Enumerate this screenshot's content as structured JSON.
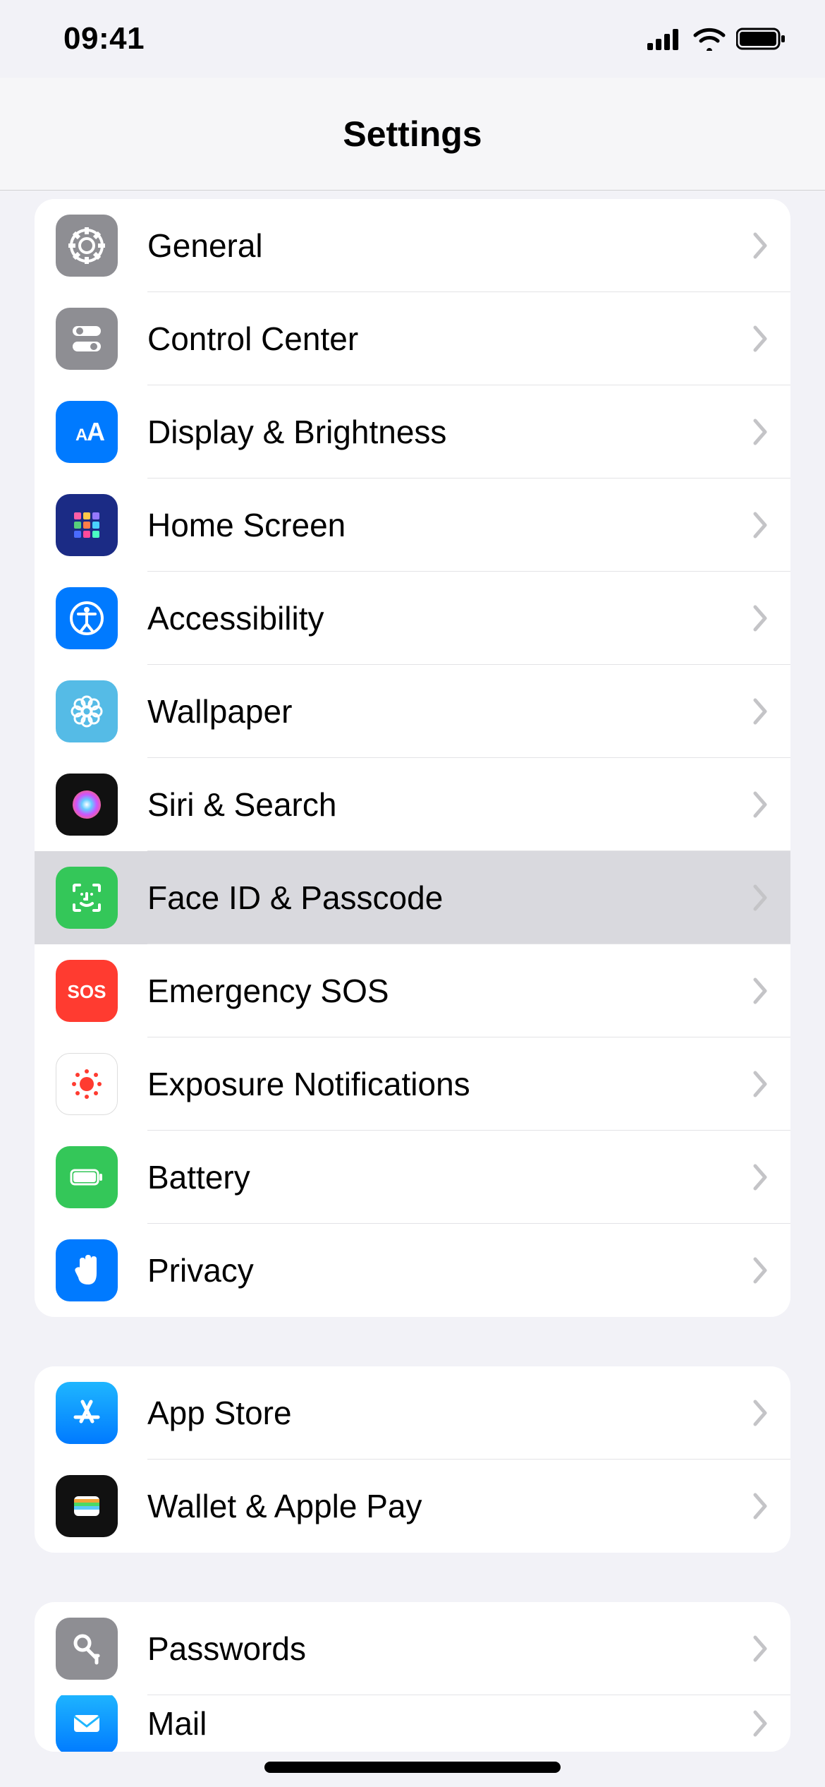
{
  "status": {
    "time": "09:41"
  },
  "nav": {
    "title": "Settings"
  },
  "sections": [
    {
      "rows": [
        {
          "id": "general",
          "label": "General"
        },
        {
          "id": "control-center",
          "label": "Control Center"
        },
        {
          "id": "display-brightness",
          "label": "Display & Brightness"
        },
        {
          "id": "home-screen",
          "label": "Home Screen"
        },
        {
          "id": "accessibility",
          "label": "Accessibility"
        },
        {
          "id": "wallpaper",
          "label": "Wallpaper"
        },
        {
          "id": "siri-search",
          "label": "Siri & Search"
        },
        {
          "id": "face-id-passcode",
          "label": "Face ID & Passcode",
          "selected": true
        },
        {
          "id": "emergency-sos",
          "label": "Emergency SOS"
        },
        {
          "id": "exposure-notifications",
          "label": "Exposure Notifications"
        },
        {
          "id": "battery",
          "label": "Battery"
        },
        {
          "id": "privacy",
          "label": "Privacy"
        }
      ]
    },
    {
      "rows": [
        {
          "id": "app-store",
          "label": "App Store"
        },
        {
          "id": "wallet-apple-pay",
          "label": "Wallet & Apple Pay"
        }
      ]
    },
    {
      "rows": [
        {
          "id": "passwords",
          "label": "Passwords"
        },
        {
          "id": "mail",
          "label": "Mail"
        }
      ]
    }
  ]
}
